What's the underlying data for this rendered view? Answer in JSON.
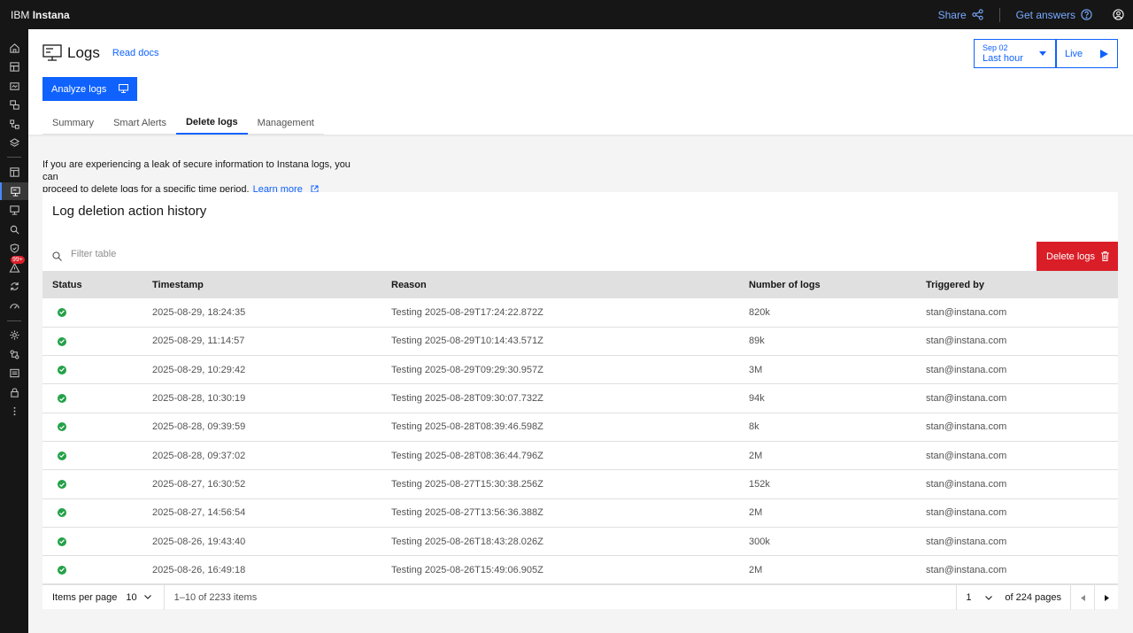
{
  "app": {
    "brand_prefix": "IBM",
    "brand_name": "Instana"
  },
  "topbar": {
    "share": "Share",
    "get_answers": "Get answers"
  },
  "page": {
    "title": "Logs",
    "read_docs": "Read docs",
    "analyze_button": "Analyze logs"
  },
  "timeframe": {
    "date": "Sep 02",
    "range": "Last hour",
    "live": "Live"
  },
  "tabs": [
    {
      "label": "Summary"
    },
    {
      "label": "Smart Alerts"
    },
    {
      "label": "Delete logs"
    },
    {
      "label": "Management"
    }
  ],
  "intro": {
    "line1": "If you are experiencing a leak of secure information to Instana logs, you can",
    "line2": "proceed to delete logs for a specific time period.",
    "learn_more": "Learn more"
  },
  "card": {
    "title": "Log deletion action history",
    "filter_placeholder": "Filter table",
    "delete_button": "Delete logs"
  },
  "table": {
    "headers": [
      "Status",
      "Timestamp",
      "Reason",
      "Number of logs",
      "Triggered by"
    ],
    "rows": [
      [
        "2025-08-29, 18:24:35",
        "Testing 2025-08-29T17:24:22.872Z",
        "820k",
        "stan@instana.com"
      ],
      [
        "2025-08-29, 11:14:57",
        "Testing 2025-08-29T10:14:43.571Z",
        "89k",
        "stan@instana.com"
      ],
      [
        "2025-08-29, 10:29:42",
        "Testing 2025-08-29T09:29:30.957Z",
        "3M",
        "stan@instana.com"
      ],
      [
        "2025-08-28, 10:30:19",
        "Testing 2025-08-28T09:30:07.732Z",
        "94k",
        "stan@instana.com"
      ],
      [
        "2025-08-28, 09:39:59",
        "Testing 2025-08-28T08:39:46.598Z",
        "8k",
        "stan@instana.com"
      ],
      [
        "2025-08-28, 09:37:02",
        "Testing 2025-08-28T08:36:44.796Z",
        "2M",
        "stan@instana.com"
      ],
      [
        "2025-08-27, 16:30:52",
        "Testing 2025-08-27T15:30:38.256Z",
        "152k",
        "stan@instana.com"
      ],
      [
        "2025-08-27, 14:56:54",
        "Testing 2025-08-27T13:56:36.388Z",
        "2M",
        "stan@instana.com"
      ],
      [
        "2025-08-26, 19:43:40",
        "Testing 2025-08-26T18:43:28.026Z",
        "300k",
        "stan@instana.com"
      ],
      [
        "2025-08-26, 16:49:18",
        "Testing 2025-08-26T15:49:06.905Z",
        "2M",
        "stan@instana.com"
      ]
    ]
  },
  "pagination": {
    "items_per_page_label": "Items per page",
    "items_per_page": "10",
    "range": "1–10 of 2233 items",
    "page": "1",
    "of_pages": "of 224 pages"
  },
  "rail": {
    "badge": "99+",
    "icons": [
      "home-icon",
      "infrastructure-icon",
      "applications-icon",
      "websites-icon",
      "platforms-icon",
      "layers-icon",
      "dashboards-icon",
      "logs-icon",
      "analytics-icon",
      "search-icon",
      "security-icon",
      "alerts-icon",
      "automation-icon",
      "gauge-icon",
      "settings-icon",
      "integrations-icon",
      "reports-icon",
      "lock-icon",
      "more-icon"
    ]
  },
  "colors": {
    "primary": "#0f62fe",
    "danger": "#da1e28",
    "success": "#24a148",
    "topbar": "#161616"
  }
}
